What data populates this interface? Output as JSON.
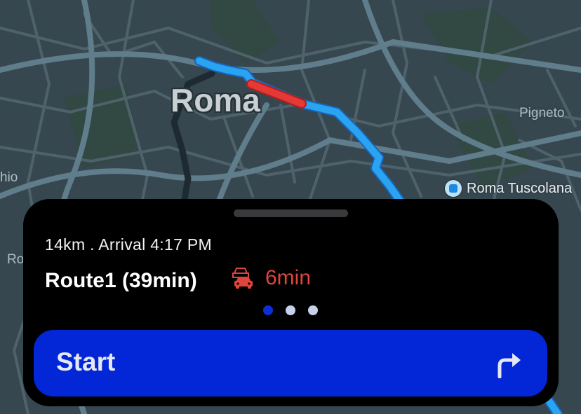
{
  "map": {
    "city_label": "Roma",
    "district_label": "Pigneto",
    "edge_label_left": "hio",
    "edge_label_left2": "Ro",
    "poi": {
      "label": "Roma Tuscolana",
      "icon": "train-station-icon"
    },
    "colors": {
      "route": "#2aa3f0",
      "traffic_segment": "#e53935",
      "alt_route": "#263238",
      "background": "#37474f",
      "roads": "#546e7a"
    }
  },
  "route_sheet": {
    "info": "14km . Arrival 4:17 PM",
    "route_name": "Route1 (39min)",
    "traffic_icon": "traffic-cars-icon",
    "traffic_delay": "6min",
    "page_count": 3,
    "active_page": 1,
    "start_button": {
      "label": "Start",
      "icon": "turn-right-arrow-icon"
    },
    "colors": {
      "accent": "#0326d6",
      "delay": "#e0453b",
      "active_dot": "#0a2fd6",
      "inactive_dot": "#c5d2ea"
    }
  }
}
